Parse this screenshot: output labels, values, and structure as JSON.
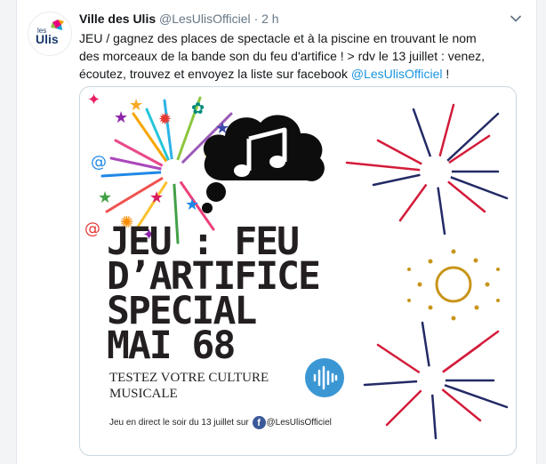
{
  "tweet": {
    "display_name": "Ville des Ulis",
    "handle": "@LesUlisOfficiel",
    "separator": "·",
    "time": "2 h",
    "text_before": "JEU / gagnez des places de spectacle et à la piscine en trouvant le nom des morceaux de la bande son du feu d'artifice ! > rdv le 13 juillet : venez, écoutez, trouvez et envoyez la liste sur facebook ",
    "mention": "@LesUlisOfficiel",
    "text_after": " !"
  },
  "avatar": {
    "small_text": "les",
    "big_text": "Ulis"
  },
  "media": {
    "headline": [
      "JEU : FEU",
      "D’ARTIFICE",
      "SPECIAL",
      "MAI 68"
    ],
    "subtitle": [
      "TESTEZ VOTRE CULTURE",
      "MUSICALE"
    ],
    "footer_text": "Jeu en direct le soir du 13 juillet sur",
    "footer_fb": "f",
    "footer_handle": "@LesUlisOfficiel"
  },
  "colors": {
    "link": "#1b95e0",
    "firework_red": "#d31c3a",
    "firework_navy": "#232a66",
    "gold": "#c8951a",
    "audio_blue": "#3a97d4",
    "facebook": "#3b5998"
  },
  "icons": [
    "ulis-logo",
    "chevron-down-icon",
    "music-note-icon",
    "sound-wave-icon",
    "facebook-icon"
  ]
}
